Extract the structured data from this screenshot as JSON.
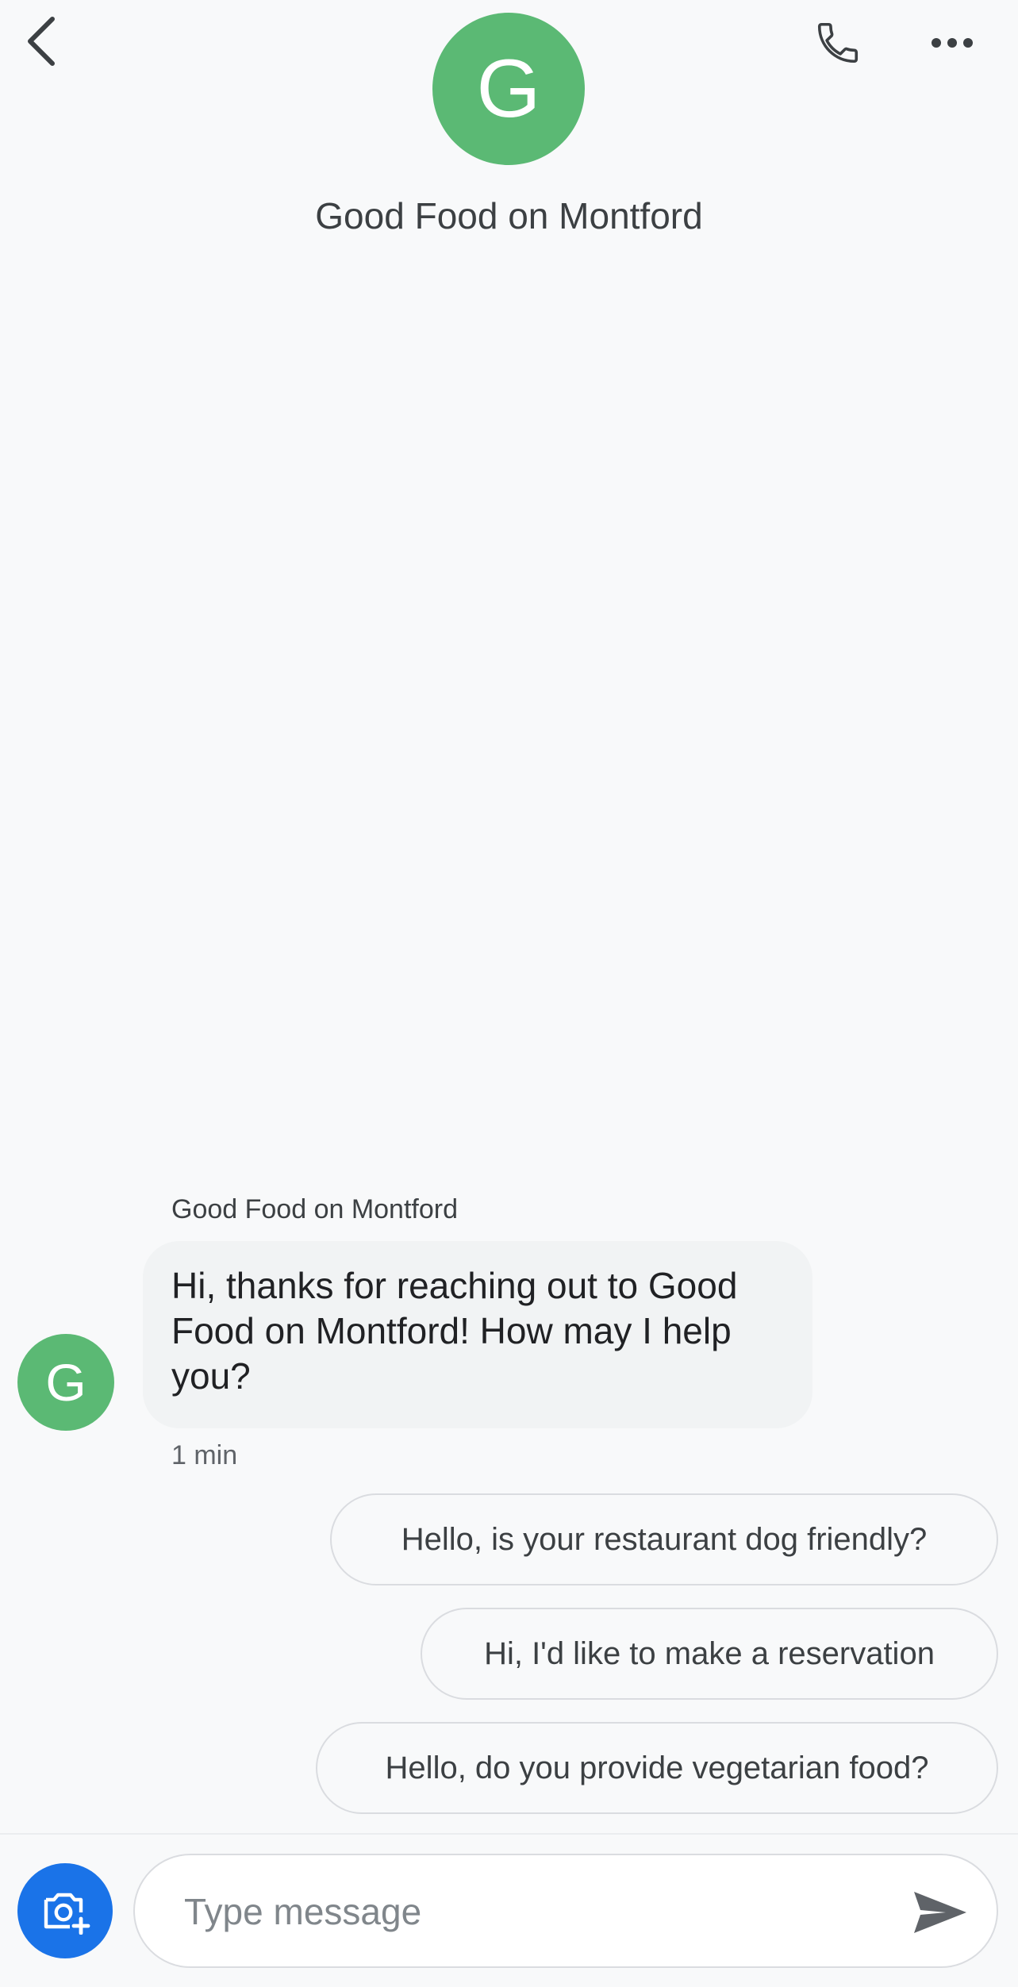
{
  "theme": {
    "avatar_color": "#5bb974",
    "accent": "#1a73e8",
    "icon_color": "#3c4043",
    "send_icon_color": "#5f6368"
  },
  "header": {
    "back_icon": "chevron-left-icon",
    "call_icon": "phone-icon",
    "more_icon": "more-horiz-icon",
    "avatar_initial": "G",
    "title": "Good Food on Montford"
  },
  "thread": {
    "messages": [
      {
        "sender": "Good Food on Montford",
        "avatar_initial": "G",
        "text": "Hi, thanks for reaching out to Good Food on Montford! How may I help you?",
        "time": "1 min"
      }
    ]
  },
  "suggestions": [
    {
      "label": "Hello, is your restaurant dog friendly?"
    },
    {
      "label": "Hi, I'd like to make a reservation"
    },
    {
      "label": "Hello, do you provide vegetarian food?"
    }
  ],
  "compose": {
    "camera_icon": "add-photo-camera-icon",
    "placeholder": "Type message",
    "value": "",
    "send_icon": "send-icon"
  }
}
